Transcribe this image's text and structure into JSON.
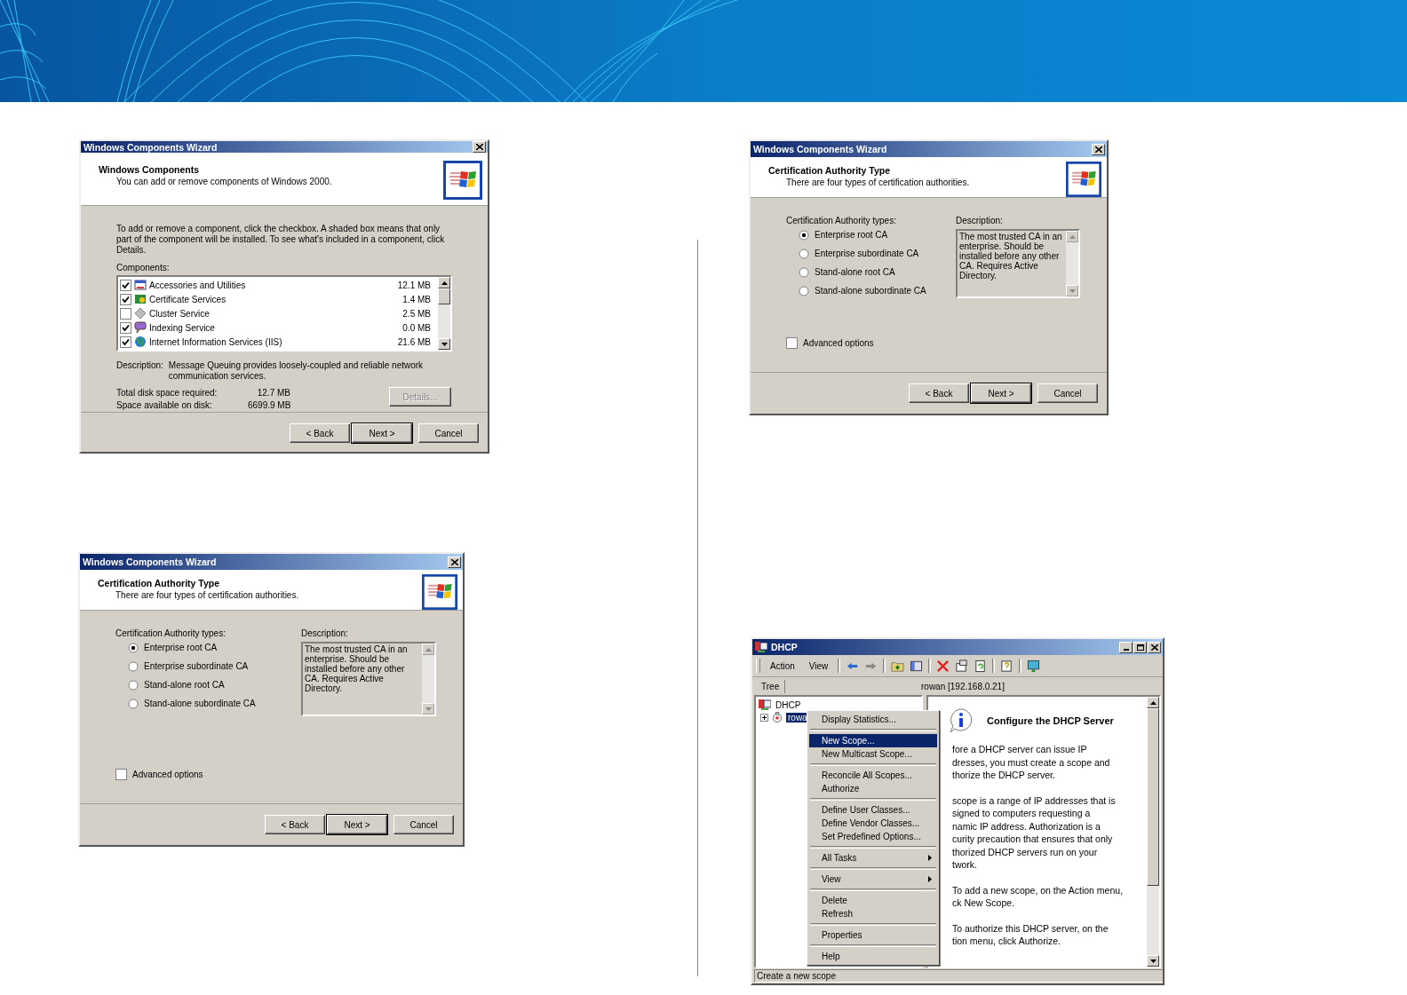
{
  "dialogs": [
    {
      "kind": "components",
      "title": "Windows Components Wizard",
      "heading": "Windows Components",
      "subheading": "You can add or remove components of Windows 2000.",
      "intro": "To add or remove a component, click the checkbox.  A shaded box means that only part of the component will be installed.  To see what's included in a component, click Details.",
      "list_label": "Components:",
      "components": [
        {
          "name": "Accessories and Utilities",
          "size": "12.1 MB",
          "checked": true
        },
        {
          "name": "Certificate Services",
          "size": "1.4 MB",
          "checked": true
        },
        {
          "name": "Cluster Service",
          "size": "2.5 MB",
          "checked": false
        },
        {
          "name": "Indexing Service",
          "size": "0.0 MB",
          "checked": true
        },
        {
          "name": "Internet Information Services (IIS)",
          "size": "21.6 MB",
          "checked": true
        }
      ],
      "description_label": "Description:",
      "description": "Message Queuing provides loosely-coupled and reliable network communication services.",
      "disk": [
        {
          "label": "Total disk space required:",
          "value": "12.7 MB"
        },
        {
          "label": "Space available on disk:",
          "value": "6699.9 MB"
        }
      ],
      "details_button": {
        "label": "Details...",
        "disabled": true
      },
      "buttons": [
        {
          "label": "< Back",
          "default": false
        },
        {
          "label": "Next >",
          "default": true
        },
        {
          "label": "Cancel",
          "default": false
        }
      ]
    },
    {
      "kind": "ca_type",
      "title": "Windows Components Wizard",
      "heading": "Certification Authority Type",
      "subheading": "There are four types of certification authorities.",
      "types_label": "Certification Authority types:",
      "options": [
        {
          "label": "Enterprise root CA",
          "selected": true
        },
        {
          "label": "Enterprise subordinate CA",
          "selected": false
        },
        {
          "label": "Stand-alone root CA",
          "selected": false
        },
        {
          "label": "Stand-alone subordinate CA",
          "selected": false
        }
      ],
      "description_label": "Description:",
      "description": "The most trusted CA in an enterprise. Should be installed before any other CA. Requires Active Directory.",
      "advanced": {
        "label": "Advanced options",
        "checked": false
      },
      "buttons": [
        {
          "label": "< Back",
          "default": false
        },
        {
          "label": "Next >",
          "default": true
        },
        {
          "label": "Cancel",
          "default": false
        }
      ]
    },
    {
      "kind": "ca_type",
      "title": "Windows Components Wizard",
      "heading": "Certification Authority Type",
      "subheading": "There are four types of certification authorities.",
      "types_label": "Certification Authority types:",
      "options": [
        {
          "label": "Enterprise root CA",
          "selected": true
        },
        {
          "label": "Enterprise subordinate CA",
          "selected": false
        },
        {
          "label": "Stand-alone root CA",
          "selected": false
        },
        {
          "label": "Stand-alone subordinate CA",
          "selected": false
        }
      ],
      "description_label": "Description:",
      "description": "The most trusted CA in an enterprise. Should be installed before any other CA. Requires Active Directory.",
      "advanced": {
        "label": "Advanced options",
        "checked": false
      },
      "buttons": [
        {
          "label": "< Back",
          "default": false
        },
        {
          "label": "Next >",
          "default": true
        },
        {
          "label": "Cancel",
          "default": false
        }
      ]
    }
  ],
  "dhcp": {
    "title": "DHCP",
    "menus": [
      "Action",
      "View"
    ],
    "tree_tab": "Tree",
    "location": "rowan [192.168.0.21]",
    "tree": [
      {
        "label": "DHCP",
        "selected": false,
        "children": [
          {
            "label": "rowa",
            "selected": true,
            "expanded": false
          }
        ]
      }
    ],
    "context_menu": [
      [
        {
          "label": "Display Statistics...",
          "selected": false,
          "submenu": false
        }
      ],
      [
        {
          "label": "New Scope...",
          "selected": true,
          "submenu": false
        },
        {
          "label": "New Multicast Scope...",
          "selected": false,
          "submenu": false
        }
      ],
      [
        {
          "label": "Reconcile All Scopes...",
          "selected": false,
          "submenu": false
        },
        {
          "label": "Authorize",
          "selected": false,
          "submenu": false
        }
      ],
      [
        {
          "label": "Define User Classes...",
          "selected": false,
          "submenu": false
        },
        {
          "label": "Define Vendor Classes...",
          "selected": false,
          "submenu": false
        },
        {
          "label": "Set Predefined Options...",
          "selected": false,
          "submenu": false
        }
      ],
      [
        {
          "label": "All Tasks",
          "selected": false,
          "submenu": true
        }
      ],
      [
        {
          "label": "View",
          "selected": false,
          "submenu": true
        }
      ],
      [
        {
          "label": "Delete",
          "selected": false,
          "submenu": false
        },
        {
          "label": "Refresh",
          "selected": false,
          "submenu": false
        }
      ],
      [
        {
          "label": "Properties",
          "selected": false,
          "submenu": false
        }
      ],
      [
        {
          "label": "Help",
          "selected": false,
          "submenu": false
        }
      ]
    ],
    "heading": "Configure the DHCP Server",
    "paragraphs": [
      [
        "fore a DHCP server can issue IP",
        "dresses, you must create a scope and",
        "thorize the DHCP server."
      ],
      [
        "scope is a range of IP addresses that is",
        "signed to computers requesting a",
        "namic IP address. Authorization is a",
        "curity precaution that ensures that only",
        "thorized DHCP servers run on your",
        "twork."
      ],
      [
        "To add a new scope, on the Action menu,",
        "ck New Scope."
      ],
      [
        "To authorize this DHCP server, on the",
        "tion menu, click Authorize."
      ]
    ],
    "status": "Create a new scope"
  }
}
